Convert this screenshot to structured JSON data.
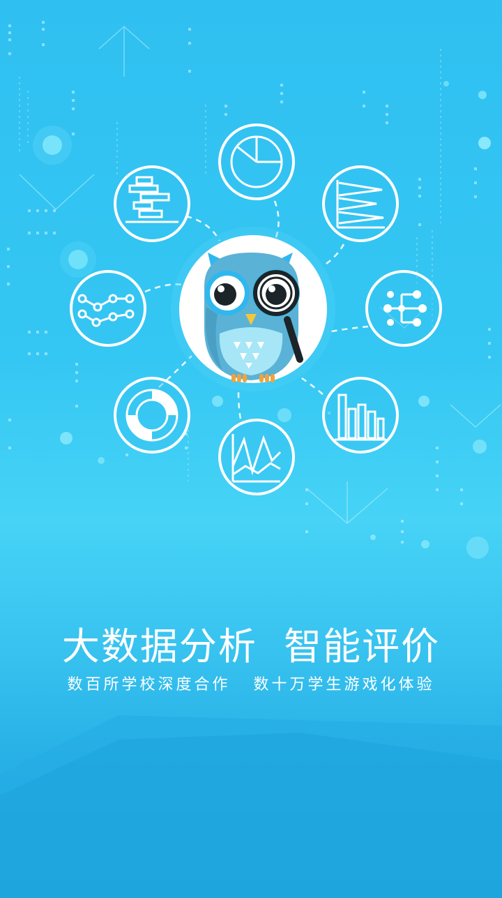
{
  "splash": {
    "headline": "大数据分析  智能评价",
    "subline": "数百所学校深度合作   数十万学生游戏化体验"
  },
  "theme": {
    "background_top": "#2fc0f1",
    "background_bottom": "#1ea6df",
    "icon_stroke": "#ffffff",
    "owl_body": "#5ab2d6",
    "owl_accent": "#2fb7ee",
    "owl_beak": "#f3c73a",
    "owl_feet": "#f4a23b"
  },
  "icons": [
    "pie-chart-icon",
    "horizontal-bar-chart-icon",
    "funnel-chart-icon",
    "line-chart-icon",
    "tree-chart-icon",
    "donut-chart-icon",
    "area-chart-icon",
    "bar-chart-icon",
    "owl-magnifier-logo"
  ]
}
